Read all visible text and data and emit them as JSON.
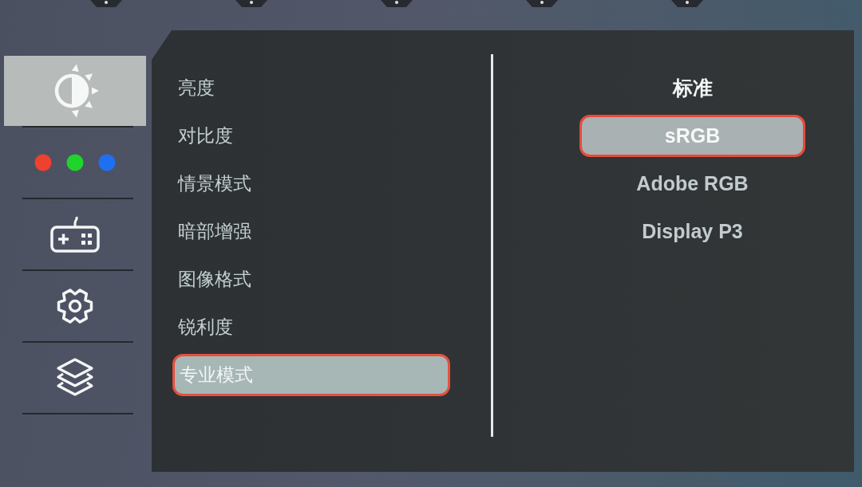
{
  "sidebar": {
    "items": [
      {
        "kind": "brightness",
        "selected": true
      },
      {
        "kind": "color",
        "selected": false
      },
      {
        "kind": "gaming",
        "selected": false
      },
      {
        "kind": "settings",
        "selected": false
      },
      {
        "kind": "layers",
        "selected": false
      }
    ]
  },
  "menu": {
    "items": [
      {
        "label": "亮度",
        "selected": false
      },
      {
        "label": "对比度",
        "selected": false
      },
      {
        "label": "情景模式",
        "selected": false
      },
      {
        "label": "暗部增强",
        "selected": false
      },
      {
        "label": "图像格式",
        "selected": false
      },
      {
        "label": "锐利度",
        "selected": false
      },
      {
        "label": "专业模式",
        "selected": true
      }
    ]
  },
  "submenu": {
    "options": [
      {
        "label": "标准",
        "selected": false,
        "current": true
      },
      {
        "label": "sRGB",
        "selected": true,
        "current": false
      },
      {
        "label": "Adobe RGB",
        "selected": false,
        "current": false
      },
      {
        "label": "Display P3",
        "selected": false,
        "current": false
      }
    ]
  }
}
